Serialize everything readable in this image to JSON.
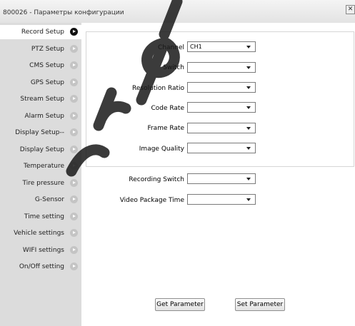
{
  "window": {
    "title": "800026 - Параметры конфигурации",
    "close_glyph": "✕"
  },
  "sidebar": {
    "items": [
      {
        "label": "Record Setup",
        "active": true
      },
      {
        "label": "PTZ Setup"
      },
      {
        "label": "CMS Setup"
      },
      {
        "label": "GPS Setup"
      },
      {
        "label": "Stream Setup"
      },
      {
        "label": "Alarm Setup"
      },
      {
        "label": "Display Setup--"
      },
      {
        "label": "Display Setup"
      },
      {
        "label": "Temperature"
      },
      {
        "label": "Tire pressure"
      },
      {
        "label": "G-Sensor"
      },
      {
        "label": "Time setting"
      },
      {
        "label": "Vehicle settings"
      },
      {
        "label": "WIFI settings"
      },
      {
        "label": "On/Off setting"
      }
    ]
  },
  "form": {
    "channel": {
      "label": "Channel",
      "value": "CH1"
    },
    "switch": {
      "label": "Switch",
      "value": ""
    },
    "resolution": {
      "label": "Resolution Ratio",
      "value": ""
    },
    "code_rate": {
      "label": "Code Rate",
      "value": ""
    },
    "frame_rate": {
      "label": "Frame Rate",
      "value": ""
    },
    "image_quality": {
      "label": "Image Quality",
      "value": ""
    },
    "recording_switch": {
      "label": "Recording Switch",
      "value": ""
    },
    "video_package_time": {
      "label": "Video Package Time",
      "value": ""
    }
  },
  "buttons": {
    "get": "Get Parameter",
    "set": "Set Parameter"
  },
  "colors": {
    "sidebar_bg": "#dcdcdc",
    "active_item_bg": "#ffffff",
    "watermark": "#1a1a1a"
  },
  "icons": {
    "nav_arrow": "circle-arrow-right-icon",
    "dropdown": "caret-down-icon",
    "close": "close-icon"
  }
}
